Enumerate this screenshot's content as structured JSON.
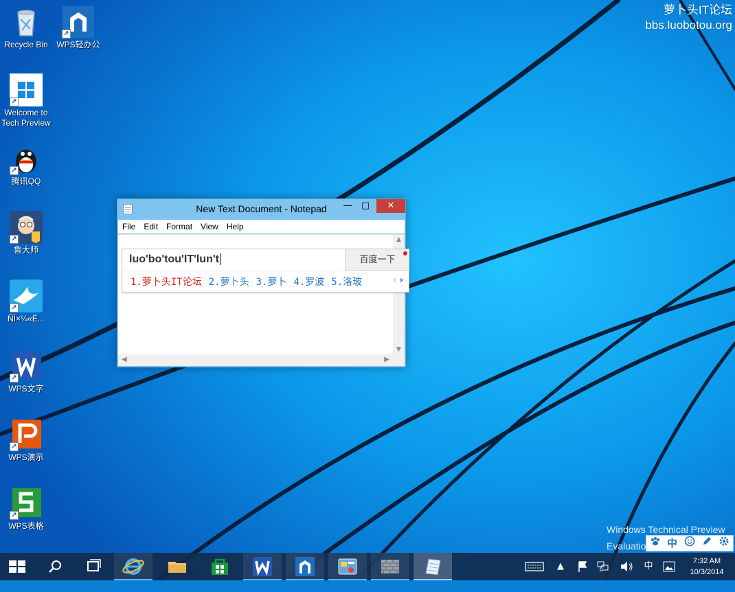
{
  "watermark": {
    "line1": "萝卜头IT论坛",
    "line2": "bbs.luobotou.org"
  },
  "desktop_icons": [
    {
      "label": "Recycle Bin"
    },
    {
      "label": "WPS轻办公"
    },
    {
      "label": "Welcome to Tech Preview"
    },
    {
      "label": "腾讯QQ"
    },
    {
      "label": "鲁大师"
    },
    {
      "label": "ÑÌ×¼«É..."
    },
    {
      "label": "WPS文字"
    },
    {
      "label": "WPS演示"
    },
    {
      "label": "WPS表格"
    }
  ],
  "notepad": {
    "title": "New Text Document - Notepad",
    "minimize_glyph": "—",
    "maximize_glyph": "□",
    "close_glyph": "✕",
    "menu": [
      "File",
      "Edit",
      "Format",
      "View",
      "Help"
    ]
  },
  "ime": {
    "input": "luo'bo'tou'IT'lun't",
    "search_button": "百度一下",
    "candidates": [
      "1.萝卜头IT论坛",
      "2.萝卜头",
      "3.萝卜",
      "4.罗波",
      "5.洛玻"
    ],
    "prev_glyph": "‹",
    "next_glyph": "›"
  },
  "imebar": {
    "icons": [
      "paw-icon",
      "chinese-mode-icon",
      "emoji-icon",
      "pen-icon",
      "settings-icon"
    ],
    "mode_label": "中"
  },
  "windows_preview": {
    "line1": "Windows Technical Preview",
    "line2": "Evaluatio"
  },
  "taskbar": {
    "items": [
      "start",
      "search",
      "task-view",
      "internet-explorer",
      "file-explorer",
      "store",
      "wps-writer",
      "wps-light-office",
      "control-panel",
      "firewall",
      "notepad"
    ],
    "ime_mode": "中",
    "time": "7:32 AM",
    "date": "10/3/2014"
  },
  "colors": {
    "desktop_bg": "#0a7fd8",
    "taskbar": "#122c4e",
    "close_button": "#c7413a",
    "title_bar": "#7ec4ef"
  }
}
